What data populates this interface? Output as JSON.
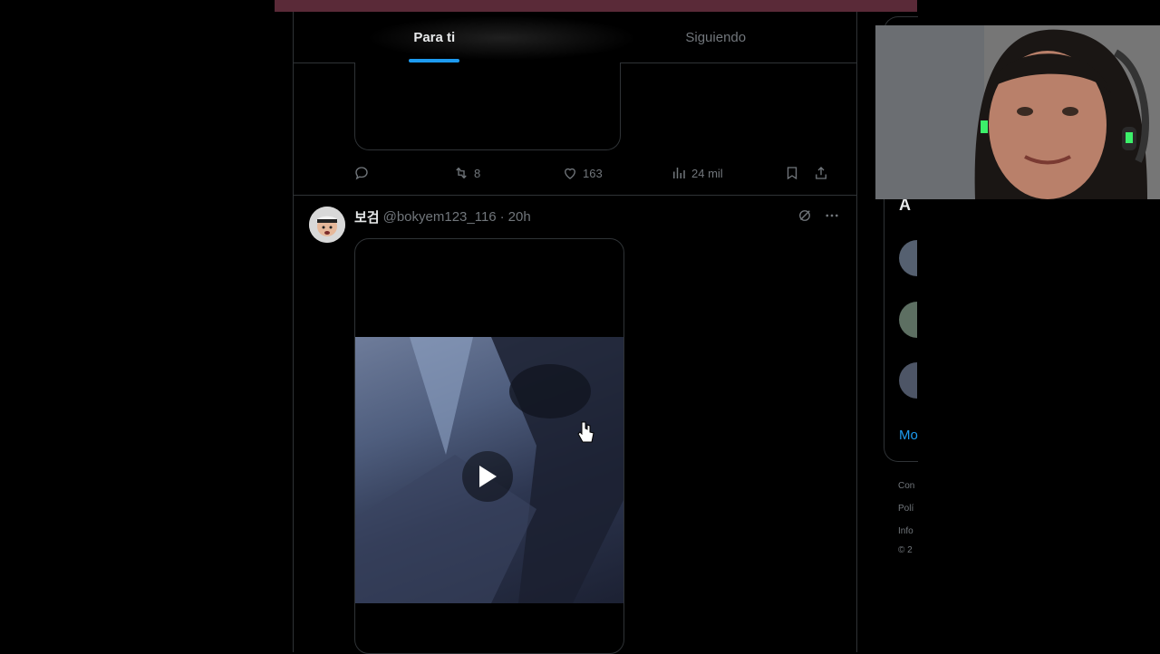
{
  "tabs": [
    {
      "label": "Para ti",
      "active": true
    },
    {
      "label": "Siguiendo",
      "active": false
    }
  ],
  "prev_tweet": {
    "reply_count": "",
    "retweet_count": "8",
    "like_count": "163",
    "views_count": "24 mil"
  },
  "tweet": {
    "name": "보검",
    "handle": "@bokyem123_116",
    "separator": "·",
    "time": "20h"
  },
  "sidebar": {
    "heading_fragment": "A",
    "more_fragment": "Mo",
    "footer": [
      "Con",
      "Polí",
      "Info",
      "© 2"
    ]
  },
  "colors": {
    "accent": "#1d9bf0",
    "background": "#000000",
    "border": "#2f3336",
    "muted_text": "#71767b",
    "top_band": "#5a2a38"
  },
  "icons": [
    "reply-icon",
    "retweet-icon",
    "like-icon",
    "views-icon",
    "bookmark-icon",
    "share-icon",
    "grok-icon",
    "more-icon",
    "play-icon",
    "cursor-icon"
  ]
}
